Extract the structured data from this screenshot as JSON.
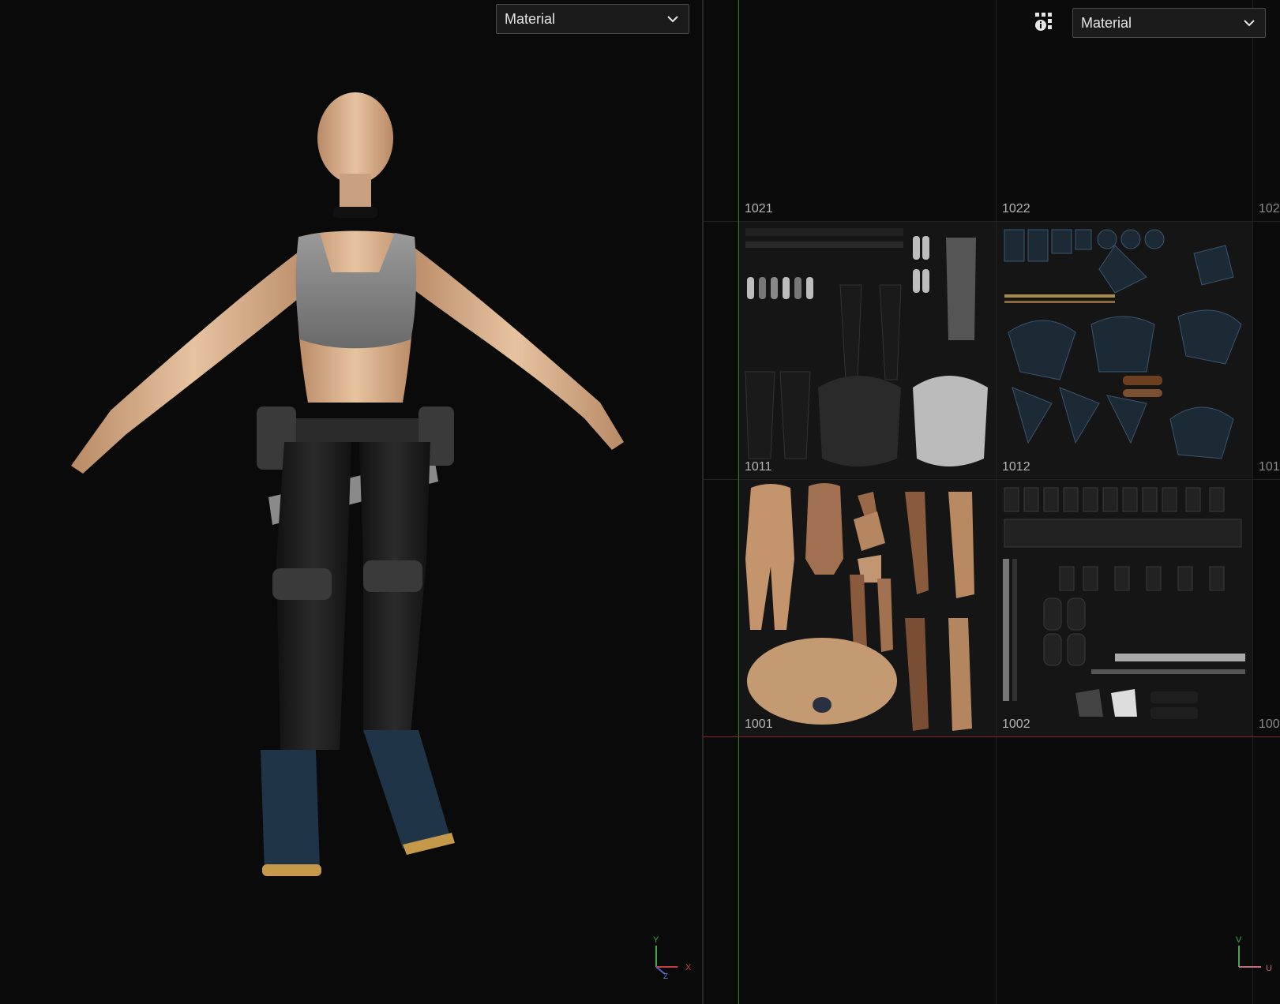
{
  "viewport": {
    "shading_dropdown": {
      "value": "Material"
    },
    "axis": {
      "y": "Y",
      "x": "X",
      "z": "Z"
    }
  },
  "uv_view": {
    "shading_dropdown": {
      "value": "Material"
    },
    "settings_icon": "grid-settings-icon",
    "tiles": [
      {
        "label": "1021"
      },
      {
        "label": "1022"
      },
      {
        "label": "102"
      },
      {
        "label": "1011"
      },
      {
        "label": "1012"
      },
      {
        "label": "101"
      },
      {
        "label": "1001"
      },
      {
        "label": "1002"
      },
      {
        "label": "100"
      }
    ],
    "axis": {
      "v": "V",
      "u": "U"
    }
  },
  "colors": {
    "background": "#0a0a0a",
    "v_axis": "#1f8a2a",
    "u_axis": "#8a1f24",
    "skin": "#d9b08a",
    "boots": "#1f3447"
  }
}
